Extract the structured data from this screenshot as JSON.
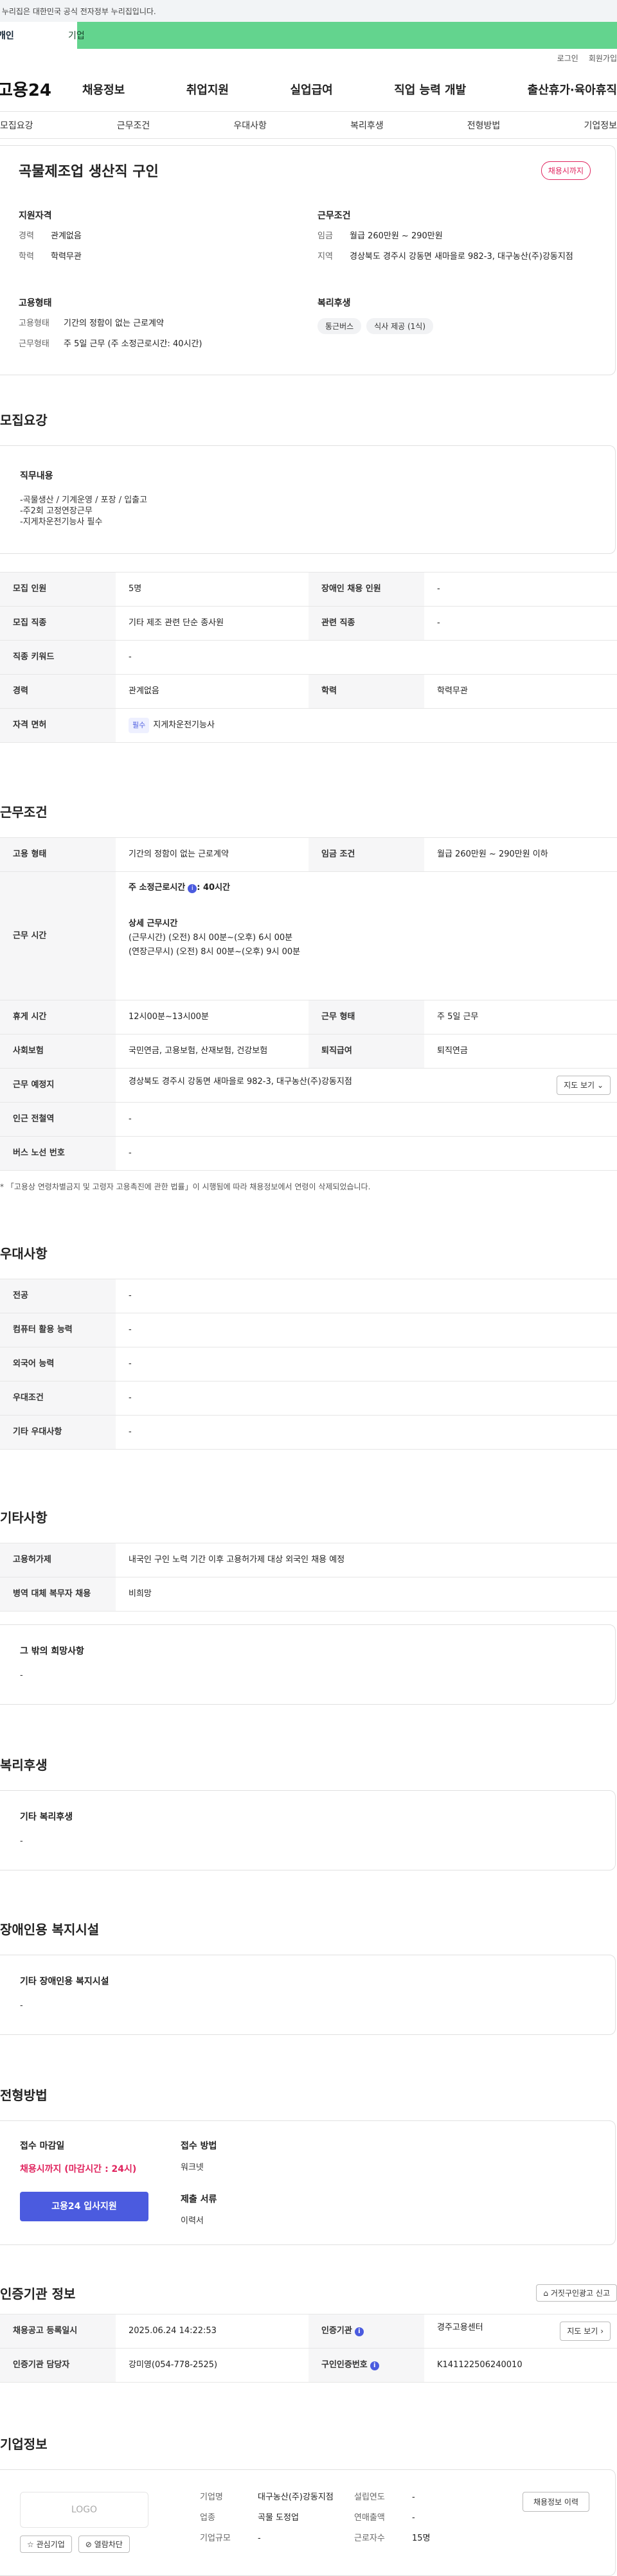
{
  "gov_banner": "이 누리집은 대한민국 공식 전자정부 누리집입니다.",
  "user_tabs": [
    "개인",
    "기업"
  ],
  "util_links": [
    "로그인",
    "회원가입"
  ],
  "logo": "고용24",
  "gnb": [
    "채용정보",
    "취업지원",
    "실업급여",
    "직업 능력 개발",
    "출산휴가·육아휴직"
  ],
  "subnav": [
    "모집요강",
    "근무조건",
    "우대사항",
    "복리후생",
    "전형방법",
    "기업정보"
  ],
  "summary": {
    "title": "곡물제조업 생산직 구인",
    "badge": "채용시까지",
    "qual_title": "지원자격",
    "qual": [
      {
        "k": "경력",
        "v": "관계없음"
      },
      {
        "k": "학력",
        "v": "학력무관"
      }
    ],
    "cond_title": "근무조건",
    "cond": [
      {
        "k": "임금",
        "v": "월급 260만원 ~ 290만원"
      },
      {
        "k": "지역",
        "v": "경상북도 경주시 강동면 새마을로 982-3, 대구농산(주)강동지점"
      }
    ],
    "type_title": "고용형태",
    "type": [
      {
        "k": "고용형태",
        "v": "기간의 정함이 없는 근로계약"
      },
      {
        "k": "근무형태",
        "v": "주 5일 근무 (주 소정근로시간: 40시간)"
      }
    ],
    "welfare_title": "복리후생",
    "welfare_chips": [
      "통근버스",
      "식사 제공 (1식)"
    ]
  },
  "recruit": {
    "title": "모집요강",
    "duty_title": "직무내용",
    "duty_lines": [
      "-곡물생산 / 기계운영 / 포장 / 입출고",
      "-주2회 고정연장근무",
      "-지게차운전기능사 필수"
    ],
    "rows": {
      "count_k": "모집 인원",
      "count_v": "5명",
      "disabled_k": "장애인 채용 인원",
      "disabled_v": "-",
      "job_k": "모집 직종",
      "job_v": "기타 제조 관련 단순 종사원",
      "rel_k": "관련 직종",
      "rel_v": "-",
      "kw_k": "직종 키워드",
      "kw_v": "-",
      "career_k": "경력",
      "career_v": "관계없음",
      "edu_k": "학력",
      "edu_v": "학력무관",
      "lic_k": "자격 면허",
      "lic_badge": "필수",
      "lic_v": "지게차운전기능사"
    }
  },
  "work": {
    "title": "근무조건",
    "type_k": "고용 형태",
    "type_v": "기간의 정함이 없는 근로계약",
    "wage_k": "임금 조건",
    "wage_v": "월급 260만원 ~ 290만원 이하",
    "hours_k": "근무 시간",
    "hours_sum": "주 소정근로시간",
    "hours_sum_v": ": 40시간",
    "hours_detail_title": "상세 근무시간",
    "hours_detail_1": "(근무시간) (오전) 8시 00분~(오후) 6시 00분",
    "hours_detail_2": "(연장근무시) (오전) 8시 00분~(오후) 9시 00분",
    "rest_k": "휴게 시간",
    "rest_v": "12시00분~13시00분",
    "form_k": "근무 형태",
    "form_v": "주 5일 근무",
    "ins_k": "사회보험",
    "ins_v": "국민연금, 고용보험, 산재보험, 건강보험",
    "ret_k": "퇴직급여",
    "ret_v": "퇴직연금",
    "place_k": "근무 예정지",
    "place_v": "경상북도 경주시 강동면 새마을로 982-3, 대구농산(주)강동지점",
    "map_btn": "지도 보기",
    "station_k": "인근 전철역",
    "station_v": "-",
    "bus_k": "버스 노선 번호",
    "bus_v": "-",
    "note": "* 「고용상 연령차별금지 및 고령자 고용촉진에 관한 법률」이 시행됨에 따라 채용정보에서 연령이 삭제되었습니다."
  },
  "pref": {
    "title": "우대사항",
    "rows": [
      {
        "k": "전공",
        "v": "-"
      },
      {
        "k": "컴퓨터 활용 능력",
        "v": "-"
      },
      {
        "k": "외국어 능력",
        "v": "-"
      },
      {
        "k": "우대조건",
        "v": "-"
      },
      {
        "k": "기타 우대사항",
        "v": "-"
      }
    ]
  },
  "etc": {
    "title": "기타사항",
    "rows": [
      {
        "k": "고용허가제",
        "v": "내국인 구인 노력 기간 이후 고용허가제 대상 외국인 채용 예정"
      },
      {
        "k": "병역 대체 복무자 채용",
        "v": "비희망"
      }
    ],
    "wish_title": "그 밖의 희망사항",
    "wish_v": "-"
  },
  "welfare": {
    "title": "복리후생",
    "box_title": "기타 복리후생",
    "box_v": "-"
  },
  "disabled": {
    "title": "장애인용 복지시설",
    "box_title": "기타 장애인용 복지시설",
    "box_v": "-"
  },
  "process": {
    "title": "전형방법",
    "deadline_title": "접수 마감일",
    "deadline_v": "채용시까지 (마감시간 : 24시)",
    "apply_btn": "고용24 입사지원",
    "method_title": "접수 방법",
    "method_v": "워크넷",
    "docs_title": "제출 서류",
    "docs_v": "이력서"
  },
  "auth": {
    "title": "인증기관 정보",
    "report_btn": "거짓구인광고 신고",
    "reg_k": "채용공고 등록일시",
    "reg_v": "2025.06.24 14:22:53",
    "org_k": "인증기관",
    "org_v": "경주고용센터",
    "map_btn": "지도 보기",
    "mgr_k": "인증기관 담당자",
    "mgr_v": "강미영(054-778-2525)",
    "no_k": "구인인증번호",
    "no_v": "K141122506240010"
  },
  "corp": {
    "title": "기업정보",
    "logo_text": "LOGO",
    "interest_btn": "관심기업",
    "block_btn": "열람차단",
    "name_k": "기업명",
    "name_v": "대구농산(주)강동지점",
    "ind_k": "업종",
    "ind_v": "곡물 도정업",
    "size_k": "기업규모",
    "size_v": "-",
    "est_k": "설립연도",
    "est_v": "-",
    "sales_k": "연매출액",
    "sales_v": "-",
    "emp_k": "근로자수",
    "emp_v": "15명",
    "more_btn": "채용정보 이력"
  }
}
